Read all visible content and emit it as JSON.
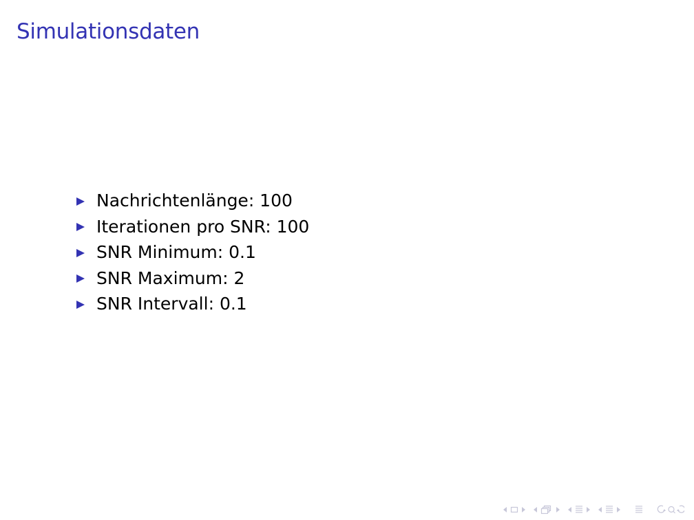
{
  "slide": {
    "title": "Simulationsdaten",
    "items": [
      {
        "text": "Nachrichtenlänge: 100"
      },
      {
        "text": "Iterationen pro SNR: 100"
      },
      {
        "text": "SNR Minimum: 0.1"
      },
      {
        "text": "SNR Maximum: 2"
      },
      {
        "text": "SNR Intervall: 0.1"
      }
    ]
  },
  "colors": {
    "title": "#3333b3",
    "bullet": "#3333b3",
    "text": "#000000",
    "navigation": "#c7c7d9"
  },
  "icons": {
    "bullet": "triangle-right-icon",
    "navigation": [
      "nav-prev-frame-icon",
      "nav-frame-icon",
      "nav-next-frame-icon",
      "nav-prev-subsection-icon",
      "nav-subsection-icon",
      "nav-next-subsection-icon",
      "nav-prev-section-icon",
      "nav-section-icon",
      "nav-next-section-icon",
      "nav-document-icon",
      "nav-search-icon"
    ]
  }
}
